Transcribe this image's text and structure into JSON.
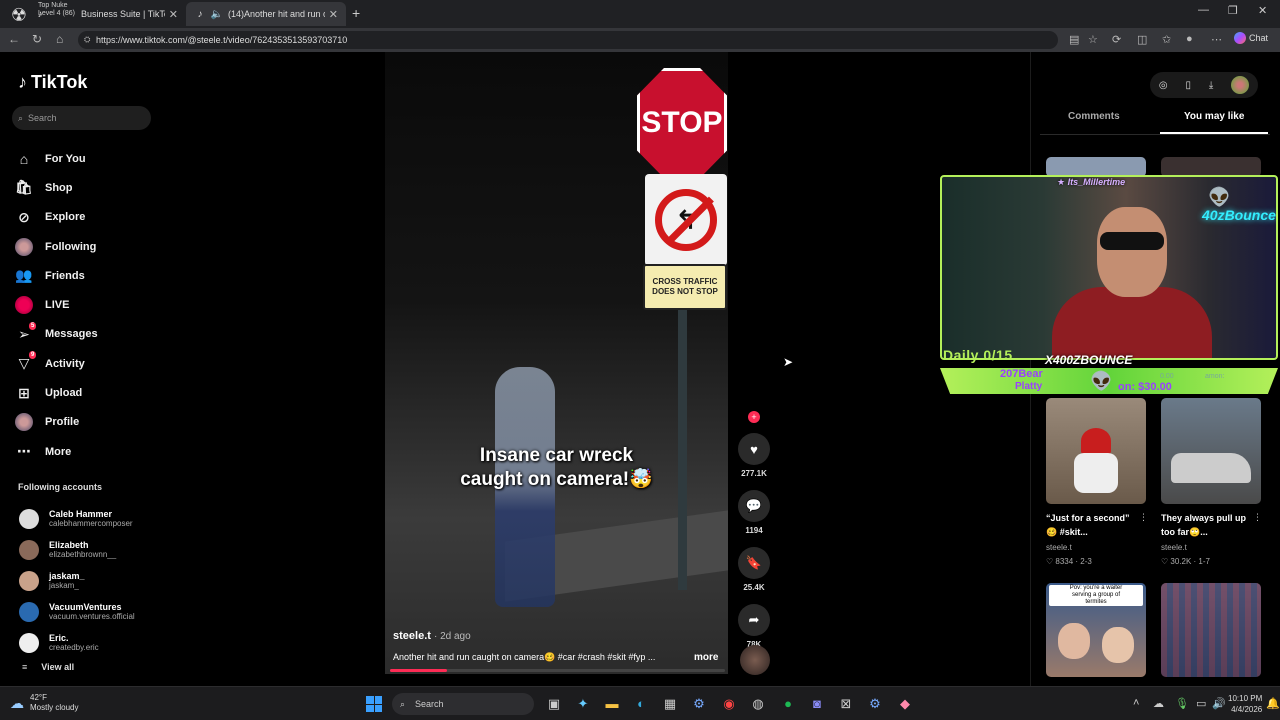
{
  "browser": {
    "profile_tip": [
      "Top Nuke",
      "Level 4 (86)"
    ],
    "tabs": [
      {
        "title": "Business Suite | TikTok"
      },
      {
        "title": "(14)Another hit and run caug"
      }
    ],
    "url": "https://www.tiktok.com/@steele.t/video/7624353513593703710",
    "chat_label": "Chat"
  },
  "sidebar": {
    "logo": "TikTok",
    "search_placeholder": "Search",
    "menu": [
      {
        "label": "For You",
        "icon": "home-icon"
      },
      {
        "label": "Shop",
        "icon": "shop-icon"
      },
      {
        "label": "Explore",
        "icon": "compass-icon"
      },
      {
        "label": "Following",
        "icon": "following-avatar"
      },
      {
        "label": "Friends",
        "icon": "friends-icon"
      },
      {
        "label": "LIVE",
        "icon": "live-icon"
      },
      {
        "label": "Messages",
        "icon": "message-icon",
        "badge": "5"
      },
      {
        "label": "Activity",
        "icon": "activity-icon",
        "badge": "9"
      },
      {
        "label": "Upload",
        "icon": "upload-icon"
      },
      {
        "label": "Profile",
        "icon": "profile-avatar"
      },
      {
        "label": "More",
        "icon": "more-icon"
      }
    ],
    "following_title": "Following accounts",
    "accounts": [
      {
        "name": "Caleb Hammer",
        "handle": "calebhammercomposer"
      },
      {
        "name": "Elizabeth",
        "handle": "elizabethbrownn__"
      },
      {
        "name": "jaskam_",
        "handle": "jaskam_"
      },
      {
        "name": "VacuumVentures",
        "handle": "vacuum.ventures.official"
      },
      {
        "name": "Eric.",
        "handle": "createdby.eric"
      }
    ],
    "view_all": "View all"
  },
  "video": {
    "signs": {
      "stop": "STOP",
      "cross_traffic": [
        "CROSS TRAFFIC",
        "DOES NOT STOP"
      ]
    },
    "caption": [
      "Insane car wreck",
      "caught on camera!🤯"
    ],
    "author": "steele.t",
    "time": "· 2d ago",
    "description": "Another hit and run caught on camera🥴 #car #crash #skit #fyp ...",
    "more": "more",
    "progress": 0.17
  },
  "actions": {
    "likes": "277.1K",
    "comments": "1194",
    "saves": "25.4K",
    "shares": "78K"
  },
  "right_panel": {
    "tabs": {
      "comments": "Comments",
      "you_may_like": "You may like"
    },
    "videos": [
      {
        "title": "“Just for a second” 🥴 #skit...",
        "author": "steele.t",
        "stats": "♡ 8334 · 2-3"
      },
      {
        "title": "They always pull up too far🙄...",
        "author": "steele.t",
        "stats": "♡ 30.2K · 1-7"
      }
    ],
    "thumb_text": [
      "Pov: you're a waiter",
      "serving a group of",
      "termites"
    ]
  },
  "stream_overlay": {
    "handle": "Its_Millertime",
    "neon_sign": "40zBounce",
    "daily": "Daily 0/15",
    "brand": "X400ZBOUNCE",
    "donor_line1": "207Bear",
    "donor_line2": "Platty",
    "goal": "on: $30.00",
    "faded_left": "0.00",
    "faded_right": "amon:"
  },
  "taskbar": {
    "weather_temp": "42°F",
    "weather_desc": "Mostly cloudy",
    "search": "Search",
    "time": "10:10 PM",
    "date": "4/4/2026"
  }
}
